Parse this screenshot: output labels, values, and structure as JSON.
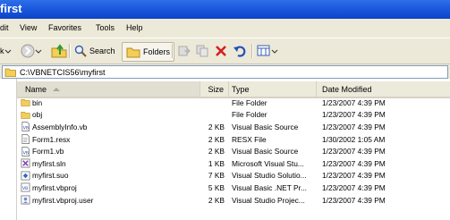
{
  "window": {
    "title": "first"
  },
  "menu": [
    "dit",
    "View",
    "Favorites",
    "Tools",
    "Help"
  ],
  "toolbar": {
    "back_label": "k",
    "search_label": "Search",
    "folders_label": "Folders"
  },
  "address": {
    "path": "C:\\VBNETCIS56\\myfirst"
  },
  "columns": {
    "name": "Name",
    "size": "Size",
    "type": "Type",
    "modified": "Date Modified"
  },
  "files": [
    {
      "name": "bin",
      "size": "",
      "type": "File Folder",
      "modified": "1/23/2007 4:39 PM",
      "icon": "folder-icon"
    },
    {
      "name": "obj",
      "size": "",
      "type": "File Folder",
      "modified": "1/23/2007 4:39 PM",
      "icon": "folder-icon"
    },
    {
      "name": "AssemblyInfo.vb",
      "size": "2 KB",
      "type": "Visual Basic Source",
      "modified": "1/23/2007 4:39 PM",
      "icon": "vb-file-icon"
    },
    {
      "name": "Form1.resx",
      "size": "2 KB",
      "type": "RESX File",
      "modified": "1/30/2002 1:05 AM",
      "icon": "resx-file-icon"
    },
    {
      "name": "Form1.vb",
      "size": "2 KB",
      "type": "Visual Basic Source",
      "modified": "1/23/2007 4:39 PM",
      "icon": "vb-file-icon"
    },
    {
      "name": "myfirst.sln",
      "size": "1 KB",
      "type": "Microsoft Visual Stu...",
      "modified": "1/23/2007 4:39 PM",
      "icon": "sln-file-icon"
    },
    {
      "name": "myfirst.suo",
      "size": "7 KB",
      "type": "Visual Studio Solutio...",
      "modified": "1/23/2007 4:39 PM",
      "icon": "suo-file-icon"
    },
    {
      "name": "myfirst.vbproj",
      "size": "5 KB",
      "type": "Visual Basic .NET Pr...",
      "modified": "1/23/2007 4:39 PM",
      "icon": "vbproj-file-icon"
    },
    {
      "name": "myfirst.vbproj.user",
      "size": "2 KB",
      "type": "Visual Studio Projec...",
      "modified": "1/23/2007 4:39 PM",
      "icon": "user-file-icon"
    }
  ]
}
